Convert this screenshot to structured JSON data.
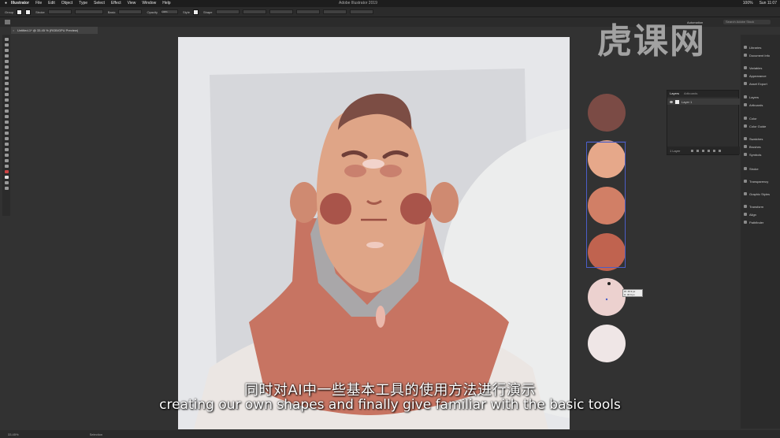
{
  "menubar": {
    "apple_icon": "apple-icon",
    "app": "Illustrator",
    "items": [
      "File",
      "Edit",
      "Object",
      "Type",
      "Select",
      "Effect",
      "View",
      "Window",
      "Help"
    ],
    "window_title": "Adobe Illustrator 2019",
    "zoom_pct": "100%",
    "clock": "Sun 11:07"
  },
  "controlbar": {
    "no_selection": "Group",
    "stroke_label": "Stroke",
    "brush_label": "Basic",
    "opacity_label": "Opacity",
    "opacity_value": "100%",
    "style_label": "Style",
    "shape_label": "Shape"
  },
  "workspace": {
    "name": "Automation",
    "search_placeholder": "Search Adobe Stock"
  },
  "doc_tab": {
    "title": "Untitled-1* @ 33.45 % (RGB/GPU Preview)"
  },
  "layers_panel": {
    "tab_layers": "Layers",
    "tab_artboards": "Artboards",
    "layer_name": "Layer 1",
    "footer": "1 Layer"
  },
  "dock": {
    "items": [
      "Libraries",
      "Document Info",
      "Variables",
      "Appearance",
      "Asset Export",
      "Layers",
      "Artboards",
      "Color",
      "Color Guide",
      "Swatches",
      "Brushes",
      "Symbols",
      "Stroke",
      "Transparency",
      "Graphic Styles",
      "Transform",
      "Align",
      "Pathfinder"
    ]
  },
  "measure": {
    "w": "W: 46.9 px",
    "h": "H: 46.9 px"
  },
  "statusbar": {
    "zoom": "33.45%",
    "tool": "Selection"
  },
  "swatch_colors": [
    "#7b4b45",
    "#e6a88a",
    "#d17f66",
    "#c0634f",
    "#ecd1cf",
    "#efe6e6"
  ],
  "subtitles": {
    "cn": "同时对AI中一些基本工具的使用方法进行演示",
    "en": "creating our own shapes and finally give familiar with the basic tools"
  },
  "watermark": "虎课网"
}
